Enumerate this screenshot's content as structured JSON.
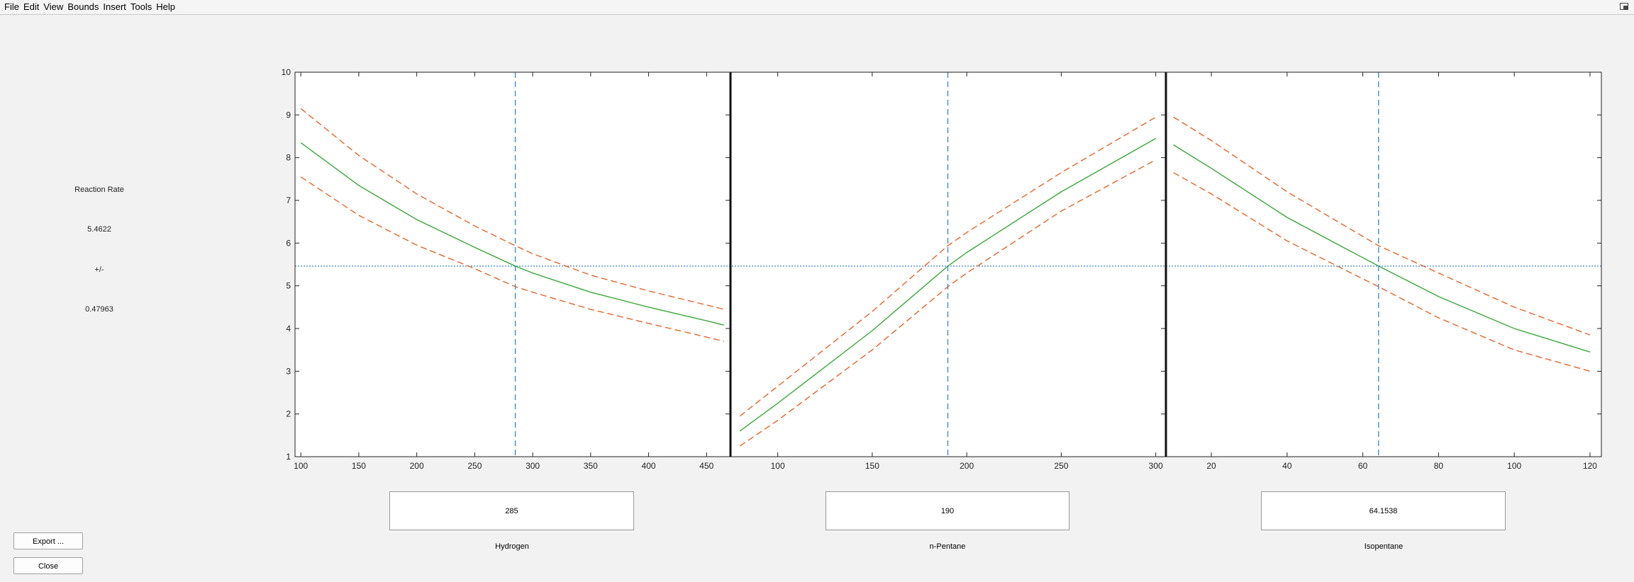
{
  "menu": [
    "File",
    "Edit",
    "View",
    "Bounds",
    "Insert",
    "Tools",
    "Help"
  ],
  "response": {
    "name": "Reaction Rate",
    "value": "5.4622",
    "pm": "+/-",
    "ci": "0.47963"
  },
  "buttons": {
    "export": "Export ...",
    "close": "Close"
  },
  "colors": {
    "fit": "#3aa83a",
    "bounds": "#e8642a",
    "xline": "#3a8fd8",
    "yline": "#4a90d0"
  },
  "chart_data": {
    "type": "line",
    "ylim": [
      1,
      10
    ],
    "yticks": [
      1,
      2,
      3,
      4,
      5,
      6,
      7,
      8,
      9,
      10
    ],
    "y_current": 5.4622,
    "panels": [
      {
        "factor": "Hydrogen",
        "value": "285",
        "current": 285,
        "xlim": [
          95,
          470
        ],
        "xticks": [
          100,
          150,
          200,
          250,
          300,
          350,
          400,
          450
        ],
        "x": [
          100,
          150,
          200,
          250,
          285,
          300,
          350,
          400,
          450,
          465
        ],
        "fit": [
          8.35,
          7.35,
          6.55,
          5.9,
          5.4622,
          5.3,
          4.85,
          4.5,
          4.18,
          4.08
        ],
        "upper": [
          9.15,
          8.05,
          7.15,
          6.4,
          5.94,
          5.75,
          5.25,
          4.88,
          4.55,
          4.45
        ],
        "lower": [
          7.55,
          6.65,
          5.95,
          5.4,
          4.98,
          4.85,
          4.45,
          4.12,
          3.8,
          3.7
        ]
      },
      {
        "factor": "n-Pentane",
        "value": "190",
        "current": 190,
        "xlim": [
          75,
          305
        ],
        "xticks": [
          100,
          150,
          200,
          250,
          300
        ],
        "x": [
          80,
          100,
          150,
          190,
          200,
          250,
          300
        ],
        "fit": [
          1.6,
          2.25,
          3.95,
          5.4622,
          5.78,
          7.2,
          8.45
        ],
        "upper": [
          1.95,
          2.65,
          4.4,
          5.94,
          6.25,
          7.65,
          8.95
        ],
        "lower": [
          1.25,
          1.85,
          3.5,
          4.98,
          5.3,
          6.75,
          7.95
        ]
      },
      {
        "factor": "Isopentane",
        "value": "64.1538",
        "current": 64.1538,
        "xlim": [
          8,
          123
        ],
        "xticks": [
          20,
          40,
          60,
          80,
          100,
          120
        ],
        "x": [
          10,
          20,
          40,
          64.1538,
          80,
          100,
          120
        ],
        "fit": [
          8.3,
          7.75,
          6.6,
          5.4622,
          4.75,
          4.0,
          3.45
        ],
        "upper": [
          8.95,
          8.4,
          7.2,
          5.94,
          5.3,
          4.5,
          3.85
        ],
        "lower": [
          7.65,
          7.15,
          6.05,
          4.98,
          4.25,
          3.5,
          3.0
        ]
      }
    ]
  }
}
